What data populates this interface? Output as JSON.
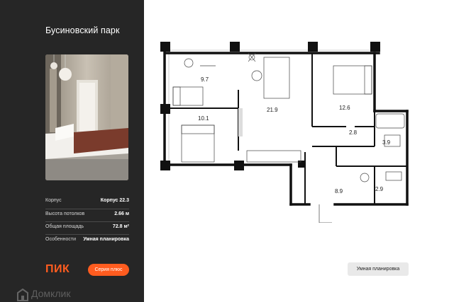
{
  "sidebar": {
    "project_title": "Бусиновский парк",
    "specs": [
      {
        "label": "Корпус",
        "value": "Корпус 22.3"
      },
      {
        "label": "Высота потолков",
        "value": "2.66 м"
      },
      {
        "label": "Общая площадь",
        "value": "72.8 м²"
      },
      {
        "label": "Особенности",
        "value": "Умная планировка"
      }
    ],
    "brand_logo": "ПИК",
    "series_badge": "Серия плюс"
  },
  "watermark": "Домклик",
  "plan": {
    "rooms": [
      {
        "id": "living-room",
        "area": "21.9"
      },
      {
        "id": "bedroom-top-left",
        "area": "9.7"
      },
      {
        "id": "bedroom-bottom-left",
        "area": "10.1"
      },
      {
        "id": "bedroom-right",
        "area": "12.6"
      },
      {
        "id": "corridor",
        "area": "2.8"
      },
      {
        "id": "bathroom",
        "area": "3.9"
      },
      {
        "id": "hall",
        "area": "8.9"
      },
      {
        "id": "toilet",
        "area": "2.9"
      }
    ],
    "feature_tag": "Умная планировка"
  },
  "colors": {
    "sidebar_bg": "#262626",
    "accent": "#ff5c1f",
    "tag_bg": "#e9e9e9"
  }
}
